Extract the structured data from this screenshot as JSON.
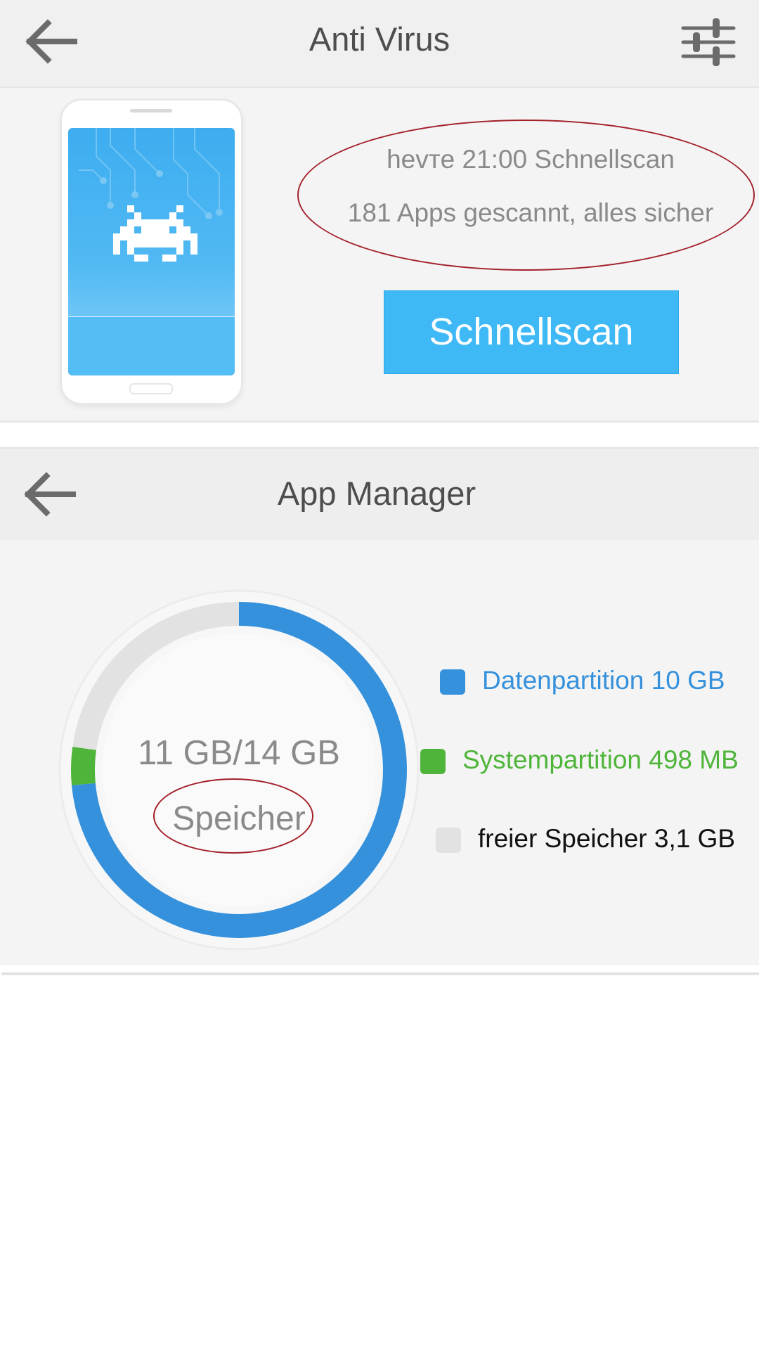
{
  "colors": {
    "accent_blue": "#3fb8f6",
    "data_partition": "#3591db",
    "system_partition": "#4fb53a",
    "free_space": "#e2e2e2",
    "annotation_red": "#a3202a"
  },
  "antivirus": {
    "title": "Anti Virus",
    "back_icon": "arrow-left-icon",
    "settings_icon": "sliders-icon",
    "scan_time_text": "hevтe 21:00 Schnellscan",
    "scan_result_text": "181 Apps gescannt, alles sicher",
    "scan_button_label": "Schnellscan"
  },
  "app_manager": {
    "title": "App Manager",
    "back_icon": "arrow-left-icon",
    "usage_text": "11 GB/14 GB",
    "usage_label": "Speicher",
    "storage": {
      "used_fraction": 0.79,
      "segments": [
        {
          "name": "Datenpartition",
          "value_gb": 10,
          "color": "#3591db"
        },
        {
          "name": "Systempartition",
          "value_gb": 0.498,
          "color": "#4fb53a"
        },
        {
          "name": "freier Speicher",
          "value_gb": 3.1,
          "color": "#e2e2e2"
        }
      ]
    },
    "legend": [
      {
        "label": "Datenpartition 10 GB",
        "color": "#3591db",
        "text_color": "#3591db"
      },
      {
        "label": "Systempartition 498 MB",
        "color": "#4fb53a",
        "text_color": "#4fb53a"
      },
      {
        "label": "freier Speicher 3,1 GB",
        "color": "#e2e2e2",
        "text_color": "#111111"
      }
    ]
  }
}
